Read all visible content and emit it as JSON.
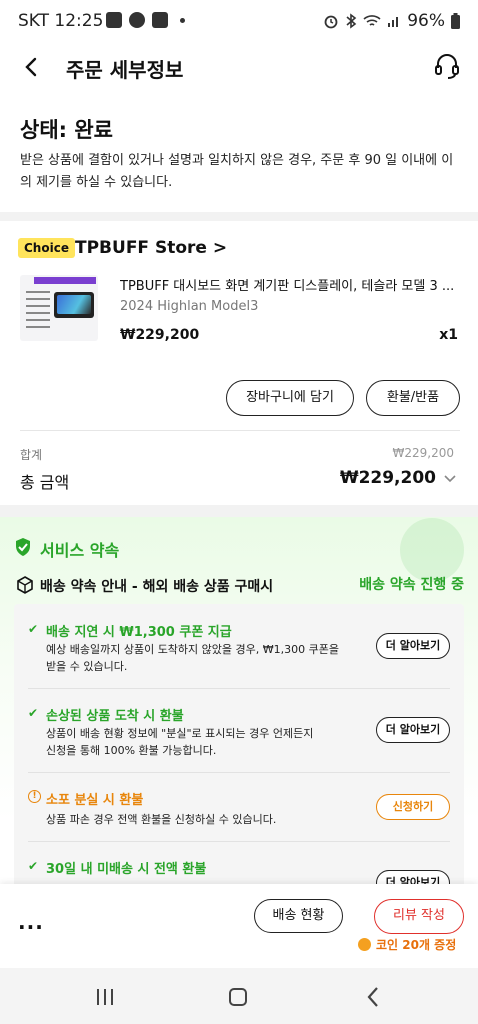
{
  "status_bar": {
    "carrier_time": "SKT 12:25",
    "battery": "96%",
    "right_icons": [
      "alarm-icon",
      "bluetooth-icon",
      "wifi-icon",
      "signal-icon",
      "battery-icon"
    ]
  },
  "header": {
    "title": "주문 세부정보",
    "icons": [
      "back-arrow-icon",
      "headset-icon"
    ]
  },
  "order": {
    "status": "상태: 완료",
    "notice": "받은 상품에 결함이 있거나 설명과 일치하지 않은 경우, 주문 후 90 일 이내에 이의 제기를 하실 수 있습니다."
  },
  "store": {
    "badge": "Choice",
    "name": "TPBUFF Store >"
  },
  "product": {
    "name": "TPBUFF 대시보드 화면 계기판 디스플레이, 테슬라 모델 3 ...",
    "variant": "2024 Highlan Model3",
    "price": "₩229,200",
    "quantity": "x1",
    "actions": {
      "add_to_cart": "장바구니에 담기",
      "refund": "환불/반품"
    }
  },
  "summary": {
    "subtotal_label": "합계",
    "subtotal_value": "₩229,200",
    "total_label": "총 금액",
    "total_value": "₩229,200"
  },
  "service": {
    "title": "서비스 약속",
    "subtitle": "배송 약속 안내 - 해외 배송 상품 구매시",
    "status": "배송 약속 진행 중",
    "items": [
      {
        "title": "배송 지연 시 ₩1,300 쿠폰 지급",
        "desc_line1": "예상 배송일까지 상품이 도착하지 않았을 경우, ₩1,300 쿠폰을",
        "desc_line2": "받을 수 있습니다.",
        "action": "더 알아보기"
      },
      {
        "title": "손상된 상품 도착 시 환불",
        "desc_line1": "상품이 배송 현황 정보에 \"분실\"로 표시되는 경우 언제든지",
        "desc_line2": "신청을 통해 100% 환불 가능합니다.",
        "action": "더 알아보기"
      },
      {
        "title": "소포 분실 시 환불",
        "desc_line1": "상품 파손 경우 전액 환불을 신청하실 수 있습니다.",
        "action": "신청하기"
      },
      {
        "title": "30일 내 미배송 시 전액 환불",
        "action": "더 알아보기"
      }
    ]
  },
  "bottom_bar": {
    "more": "...",
    "tracking": "배송 현황",
    "review": "리뷰 작성",
    "coin_reward": "코인 20개 증정"
  },
  "colors": {
    "accent_green": "#2aa52a",
    "accent_orange": "#e8860c",
    "review_red": "#e0302c",
    "choice_yellow": "#ffe45c"
  }
}
